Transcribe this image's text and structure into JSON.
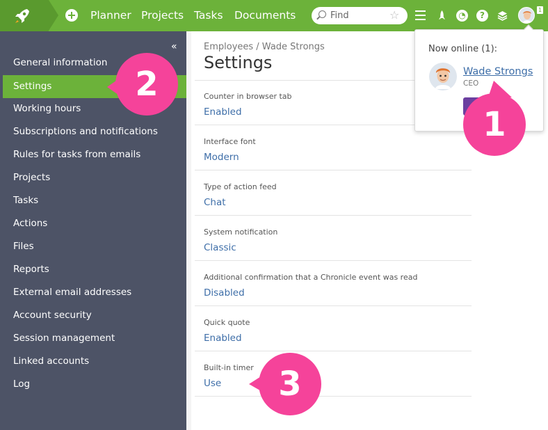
{
  "topbar": {
    "nav": [
      "Planner",
      "Projects",
      "Tasks",
      "Documents"
    ],
    "search_placeholder": "Find",
    "notification_count": "1"
  },
  "sidebar": {
    "collapse_glyph": "«",
    "items": [
      {
        "label": "General information"
      },
      {
        "label": "Settings",
        "active": true
      },
      {
        "label": "Working hours"
      },
      {
        "label": "Subscriptions and notifications"
      },
      {
        "label": "Rules for tasks from emails"
      },
      {
        "label": "Projects"
      },
      {
        "label": "Tasks"
      },
      {
        "label": "Actions"
      },
      {
        "label": "Files"
      },
      {
        "label": "Reports"
      },
      {
        "label": "External email addresses"
      },
      {
        "label": "Account security"
      },
      {
        "label": "Session management"
      },
      {
        "label": "Linked accounts"
      },
      {
        "label": "Log"
      }
    ]
  },
  "main": {
    "breadcrumb": "Employees / Wade Strongs",
    "title": "Settings",
    "fields": [
      {
        "label": "Counter in browser tab",
        "value": "Enabled"
      },
      {
        "label": "Interface font",
        "value": "Modern"
      },
      {
        "label": "Type of action feed",
        "value": "Chat"
      },
      {
        "label": "System notification",
        "value": "Classic"
      },
      {
        "label": "Additional confirmation that a Chronicle event was read",
        "value": "Disabled"
      },
      {
        "label": "Quick quote",
        "value": "Enabled"
      },
      {
        "label": "Built-in timer",
        "value": "Use"
      }
    ]
  },
  "online_popup": {
    "title": "Now online (1):",
    "user_name": "Wade Strongs",
    "user_role": "CEO"
  },
  "callouts": [
    "1",
    "2",
    "3"
  ],
  "colors": {
    "brand_green": "#6cb23a",
    "sidebar_bg": "#4d5366",
    "link_blue": "#3e6ea8",
    "callout_pink": "#f5439a",
    "button_purple": "#6b3fa0"
  }
}
